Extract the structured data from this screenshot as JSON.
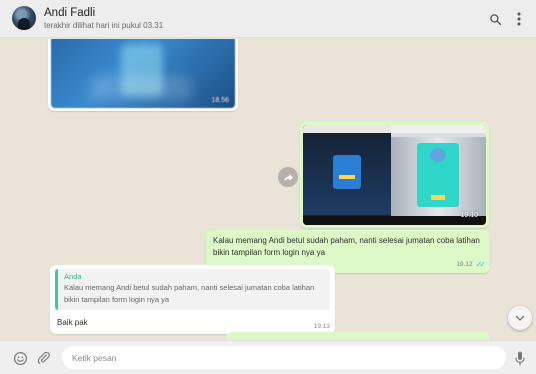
{
  "header": {
    "contact_name": "Andi Fadli",
    "last_seen": "terakhir dilihat hari ini pukul 03.31",
    "icons": [
      "search-icon",
      "menu-icon"
    ]
  },
  "messages": [
    {
      "type": "image",
      "direction": "in",
      "time": "18.56"
    },
    {
      "type": "image",
      "direction": "out",
      "time": "19.10",
      "status": "read"
    },
    {
      "type": "text",
      "direction": "out",
      "text": "Kalau memang Andi betul sudah paham, nanti selesai jumatan coba latihan bikin tampilan form login nya ya",
      "time": "19.12",
      "status": "read"
    },
    {
      "type": "reply",
      "direction": "in",
      "quote_author": "Anda",
      "quote_text": "Kalau memang Andi betul sudah paham, nanti selesai jumatan coba latihan bikin tampilan form login nya ya",
      "text": "Baik pak",
      "time": "19.13"
    }
  ],
  "composer": {
    "placeholder": "Ketik pesan",
    "icons": [
      "emoji-icon",
      "attach-icon",
      "mic-icon"
    ]
  },
  "colors": {
    "outgoing_bubble": "#dbf8c6",
    "incoming_bubble": "#ffffff",
    "chat_background": "#e9e3d8",
    "read_ticks": "#4fb6ec",
    "quote_accent": "#35cd96"
  }
}
